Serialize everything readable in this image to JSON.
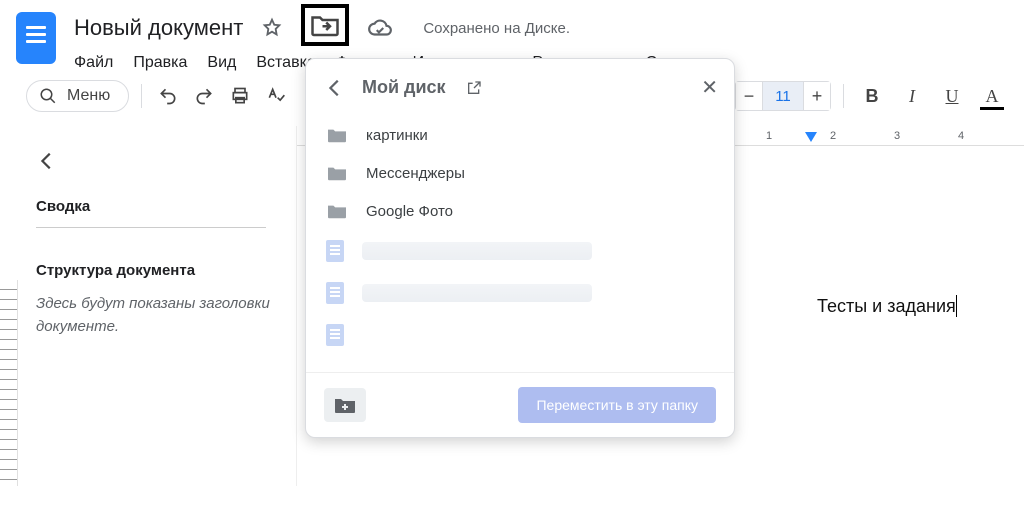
{
  "header": {
    "title": "Новый документ",
    "saved": "Сохранено на Диске.",
    "menus": [
      "Файл",
      "Правка",
      "Вид",
      "Вставка",
      "Формат",
      "Инструменты",
      "Расширения",
      "Справка"
    ]
  },
  "toolbar": {
    "menu_search_label": "Меню",
    "font_size": "11"
  },
  "ruler": {
    "ticks": [
      "1",
      "2",
      "3",
      "4"
    ]
  },
  "outline": {
    "summary_label": "Сводка",
    "structure_label": "Структура документа",
    "hint": "Здесь будут показаны заголовки документе."
  },
  "document": {
    "body_text": "Тесты и задания"
  },
  "dialog": {
    "title": "Мой диск",
    "folders": [
      "картинки",
      "Мессенджеры",
      "Google Фото"
    ],
    "move_button": "Переместить в эту папку"
  }
}
